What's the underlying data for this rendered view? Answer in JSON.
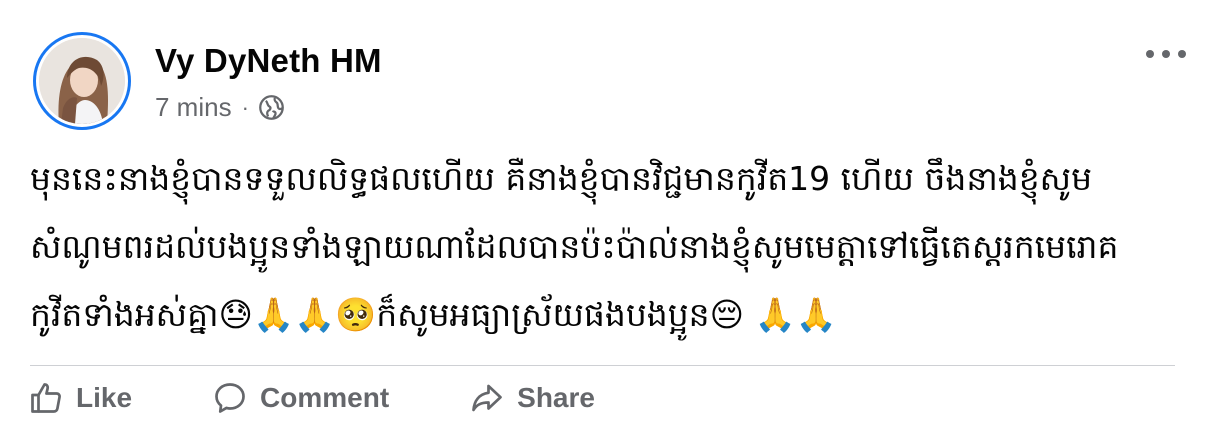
{
  "post": {
    "author": "Vy DyNeth HM",
    "time": "7 mins",
    "separator": "·",
    "privacy_icon": "globe-icon",
    "text_lines": [
      "មុននេះនាងខ្ញុំបានទទួលលិទ្ធផលហើយ គឺនាងខ្ញុំបានវិជ្ជមានកូវីត19 ហើយ ចឹងនាងខ្ញុំសូម",
      "សំណូមពរដល់បងប្អូនទាំងឡាយណាដែលបានប៉ះប៉ាល់នាងខ្ញុំសូមមេត្តាទៅធ្វើតេស្តរកមេរោគ",
      "កូវីតទាំងអស់គ្នា",
      "ក៏សូមអធ្យាស្រ័យផងបងប្អូន"
    ],
    "emojis": [
      "😓",
      "🙏",
      "🙏",
      "🥺",
      "😔",
      "🙏",
      "🙏"
    ]
  },
  "actions": {
    "like": "Like",
    "comment": "Comment",
    "share": "Share"
  },
  "colors": {
    "accent": "#1877f2",
    "secondary_text": "#65676b",
    "primary_text": "#050505",
    "divider": "#ced0d4"
  }
}
